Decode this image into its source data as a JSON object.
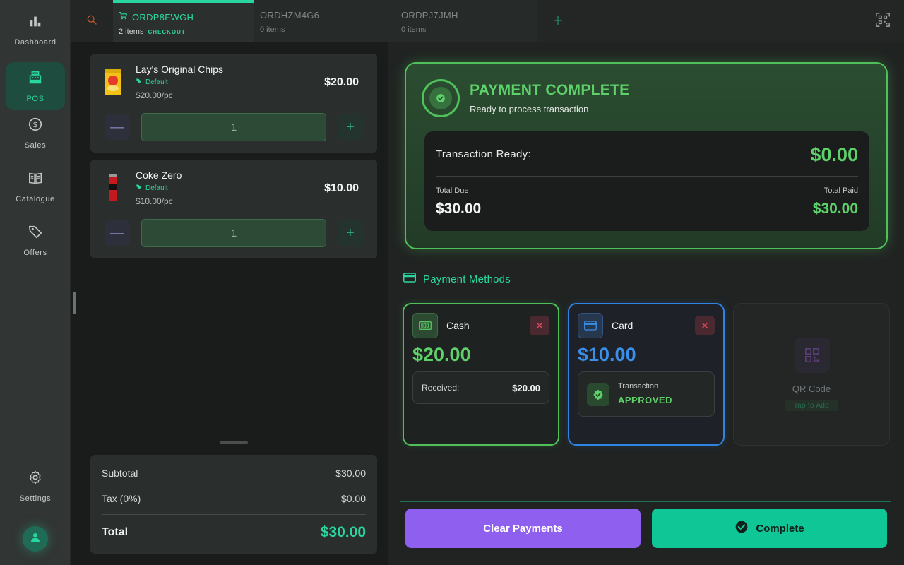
{
  "sidebar": {
    "items": [
      {
        "label": "Dashboard",
        "icon": "bar-chart-icon"
      },
      {
        "label": "POS",
        "icon": "cash-register-icon"
      },
      {
        "label": "Sales",
        "icon": "dollar-icon"
      },
      {
        "label": "Catalogue",
        "icon": "book-icon"
      },
      {
        "label": "Offers",
        "icon": "tag-icon"
      }
    ],
    "settings_label": "Settings",
    "active": "POS"
  },
  "tabs": [
    {
      "id": "ORDP8FWGH",
      "count": "2 items",
      "badge": "CHECKOUT",
      "active": true
    },
    {
      "id": "ORDHZM4G6",
      "count": "0 items"
    },
    {
      "id": "ORDPJ7JMH",
      "count": "0 items"
    }
  ],
  "cart": {
    "items": [
      {
        "name": "Lay's Original Chips",
        "variant": "Default",
        "unit_price": "$20.00/pc",
        "price": "$20.00",
        "qty": "1"
      },
      {
        "name": "Coke Zero",
        "variant": "Default",
        "unit_price": "$10.00/pc",
        "price": "$10.00",
        "qty": "1"
      }
    ],
    "summary": {
      "subtotal_label": "Subtotal",
      "subtotal": "$30.00",
      "tax_label": "Tax (0%)",
      "tax": "$0.00",
      "total_label": "Total",
      "total": "$30.00"
    }
  },
  "payment": {
    "status_title": "PAYMENT COMPLETE",
    "status_sub": "Ready to process transaction",
    "ready_label": "Transaction Ready:",
    "ready_value": "$0.00",
    "due_label": "Total Due",
    "due_value": "$30.00",
    "paid_label": "Total Paid",
    "paid_value": "$30.00",
    "methods_title": "Payment Methods",
    "cash": {
      "name": "Cash",
      "amount": "$20.00",
      "received_label": "Received:",
      "received_value": "$20.00"
    },
    "card": {
      "name": "Card",
      "amount": "$10.00",
      "tx_label": "Transaction",
      "tx_status": "APPROVED"
    },
    "qr": {
      "name": "QR Code",
      "hint": "Tap to Add"
    },
    "clear_label": "Clear Payments",
    "complete_label": "Complete"
  },
  "colors": {
    "accent": "#2ad6a0",
    "success": "#5ed16a",
    "card_blue": "#3990ea",
    "clear_purple": "#8f5ff0",
    "danger": "#e14a5e"
  }
}
